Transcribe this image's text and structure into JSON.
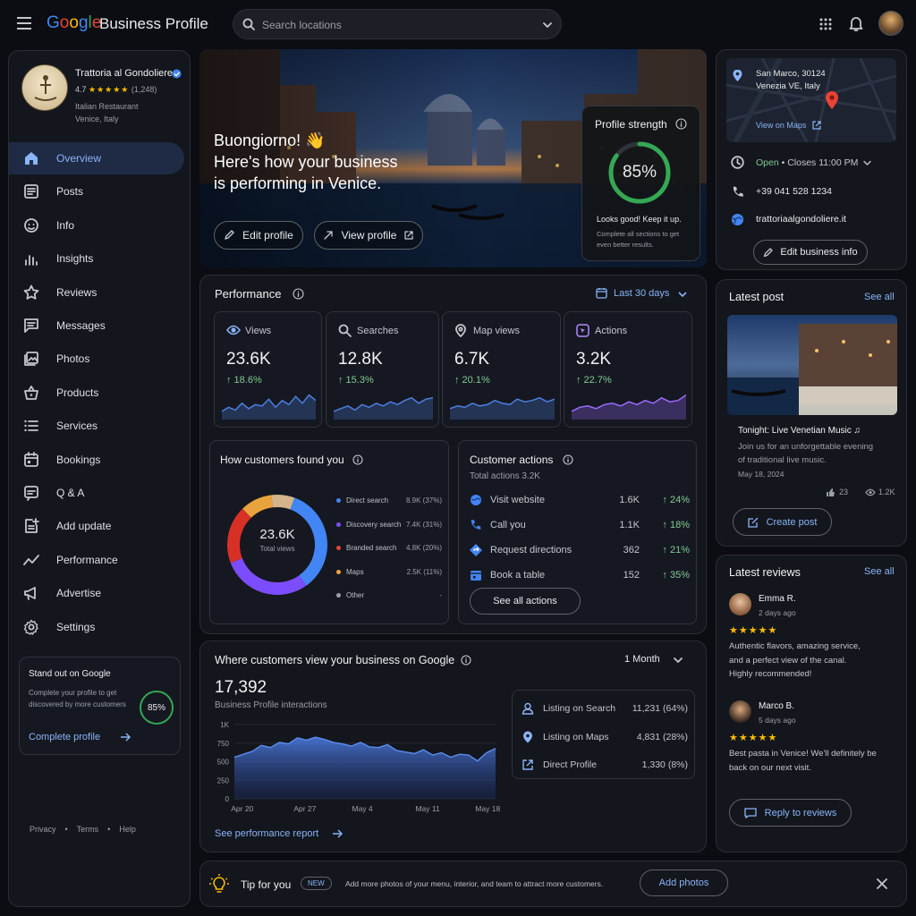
{
  "app": {
    "brand_product": "Business Profile",
    "search_placeholder": "Search locations"
  },
  "business": {
    "name": "Trattoria al Gondoliere",
    "rating": "4.7",
    "reviews": "(1,248)",
    "category": "Italian Restaurant",
    "location": "Venice, Italy"
  },
  "nav": [
    {
      "label": "Overview",
      "icon": "home-icon"
    },
    {
      "label": "Posts",
      "icon": "posts-icon"
    },
    {
      "label": "Info",
      "icon": "info-icon"
    },
    {
      "label": "Insights",
      "icon": "insights-icon"
    },
    {
      "label": "Reviews",
      "icon": "star-icon"
    },
    {
      "label": "Messages",
      "icon": "messages-icon"
    },
    {
      "label": "Photos",
      "icon": "photos-icon"
    },
    {
      "label": "Products",
      "icon": "basket-icon"
    },
    {
      "label": "Services",
      "icon": "list-icon"
    },
    {
      "label": "Bookings",
      "icon": "calendar-icon"
    },
    {
      "label": "Q & A",
      "icon": "qa-icon"
    },
    {
      "label": "Add update",
      "icon": "add-update-icon"
    },
    {
      "label": "Performance",
      "icon": "trend-icon"
    },
    {
      "label": "Advertise",
      "icon": "megaphone-icon"
    },
    {
      "label": "Settings",
      "icon": "gear-icon"
    }
  ],
  "promo": {
    "title": "Stand out on Google",
    "text": "Complete your profile to get discovered by more customers",
    "percent": "85%",
    "cta": "Complete profile"
  },
  "footer_links": [
    "Privacy",
    "Terms",
    "Help"
  ],
  "hero": {
    "greeting": "Buongiorno! 👋",
    "line2": "Here's how your business",
    "line3": "is performing in Venice.",
    "edit_btn": "Edit profile",
    "view_btn": "View profile"
  },
  "strength": {
    "title": "Profile strength",
    "percent_text": "85%",
    "percent": 0.85,
    "note": "Looks good! Keep it up.",
    "sub": "Complete all sections to get even better results."
  },
  "performance": {
    "title": "Performance",
    "range": "Last 30 days",
    "metrics": [
      {
        "label": "Views",
        "value": "23.6K",
        "change": "↑ 18.6%",
        "icon": "eye-icon"
      },
      {
        "label": "Searches",
        "value": "12.8K",
        "change": "↑ 15.3%",
        "icon": "search-icon"
      },
      {
        "label": "Map views",
        "value": "6.7K",
        "change": "↑ 20.1%",
        "icon": "pin-icon"
      },
      {
        "label": "Actions",
        "value": "3.2K",
        "change": "↑ 22.7%",
        "icon": "cursor-icon"
      }
    ]
  },
  "found": {
    "title": "How customers found you",
    "center_value": "23.6K",
    "center_label": "Total views",
    "legend": [
      {
        "label": "Direct search",
        "value": "8.9K (37%)",
        "color": "#4285f4"
      },
      {
        "label": "Discovery search",
        "value": "7.4K (31%)",
        "color": "#7c4dff"
      },
      {
        "label": "Branded search",
        "value": "4.8K (20%)",
        "color": "#ea4335"
      },
      {
        "label": "Maps",
        "value": "2.5K (11%)",
        "color": "#f4a03c"
      },
      {
        "label": "Other",
        "value": "-",
        "color": "#9aa0a6"
      }
    ]
  },
  "customer_actions": {
    "title": "Customer actions",
    "total": "Total actions 3.2K",
    "rows": [
      {
        "label": "Visit website",
        "value": "1.6K",
        "change": "↑ 24%",
        "icon": "globe-icon"
      },
      {
        "label": "Call you",
        "value": "1.1K",
        "change": "↑ 18%",
        "icon": "phone-icon"
      },
      {
        "label": "Request directions",
        "value": "362",
        "change": "↑ 21%",
        "icon": "directions-icon"
      },
      {
        "label": "Book a table",
        "value": "152",
        "change": "↑ 35%",
        "icon": "calendar-icon"
      }
    ],
    "cta": "See all actions"
  },
  "where": {
    "title": "Where customers view your business on Google",
    "range": "1 Month",
    "total": "17,392",
    "subtitle": "Business Profile interactions",
    "breakdown": [
      {
        "label": "Listing on Search",
        "value": "11,231 (64%)",
        "icon": "person-icon"
      },
      {
        "label": "Listing on Maps",
        "value": "4,831 (28%)",
        "icon": "pin-icon"
      },
      {
        "label": "Direct Profile",
        "value": "1,330 (8%)",
        "icon": "external-icon"
      }
    ],
    "link": "See performance report"
  },
  "chart_data": {
    "type": "area",
    "yticks": [
      "1K",
      "750",
      "500",
      "250",
      "0"
    ],
    "ylim": [
      0,
      1000
    ],
    "xticks": [
      "Apr 20",
      "Apr 27",
      "May 4",
      "May 11",
      "May 18"
    ],
    "x": [
      1,
      2,
      3,
      4,
      5,
      6,
      7,
      8,
      9,
      10,
      11,
      12,
      13,
      14,
      15,
      16,
      17,
      18,
      19,
      20,
      21,
      22,
      23,
      24,
      25,
      26,
      27,
      28,
      29,
      30
    ],
    "values": [
      560,
      600,
      640,
      720,
      690,
      760,
      740,
      820,
      790,
      830,
      800,
      760,
      740,
      710,
      760,
      700,
      690,
      730,
      650,
      630,
      610,
      660,
      590,
      620,
      560,
      600,
      590,
      510,
      620,
      680
    ],
    "series": [
      {
        "name": "Business Profile interactions"
      }
    ]
  },
  "map": {
    "address1": "San Marco, 30124",
    "address2": "Venezia VE, Italy",
    "link": "View on Maps"
  },
  "contact": {
    "open": "Open",
    "closes": "• Closes 11:00 PM",
    "phone": "+39 041 528 1234",
    "website": "trattoriaalgondoliere.it",
    "edit": "Edit business info"
  },
  "latest_post": {
    "title": "Latest post",
    "see_all": "See all",
    "post_title": "Tonight: Live Venetian Music ♫",
    "text": "Join us for an unforgettable evening of traditional live music.",
    "date": "May 18, 2024",
    "likes": "23",
    "views": "1.2K",
    "cta": "Create post"
  },
  "reviews": {
    "title": "Latest reviews",
    "see_all": "See all",
    "items": [
      {
        "name": "Emma R.",
        "when": "2 days ago",
        "stars": "★★★★★",
        "text": "Authentic flavors, amazing service, and a perfect view of the canal. Highly recommended!"
      },
      {
        "name": "Marco B.",
        "when": "5 days ago",
        "stars": "★★★★★",
        "text": "Best pasta in Venice! We'll definitely be back on our next visit."
      }
    ],
    "cta": "Reply to reviews"
  },
  "tip": {
    "title": "Tip for you",
    "badge": "NEW",
    "text": "Add more photos of your menu, interior, and team to attract more customers.",
    "cta": "Add photos"
  },
  "colors": {
    "accent": "#8ab4f8",
    "positive": "#81c995",
    "ring": "#34a853"
  }
}
